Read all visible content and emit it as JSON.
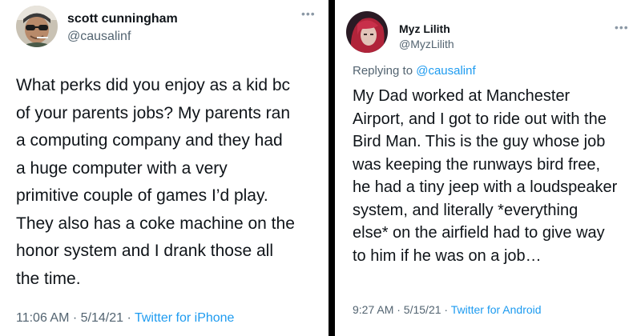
{
  "tweet_left": {
    "author_name": "scott cunningham",
    "author_handle": "@causalinf",
    "more_icon": "more-dots-icon",
    "lines": [
      "What perks did you enjoy as a kid bc",
      "of your parents jobs? My parents ran",
      "a computing company and they had",
      "a huge computer with a very",
      "primitive couple of games I’d play.",
      "They also has a coke machine on the",
      "honor system and I drank those all",
      "the time."
    ],
    "time": "11:06 AM · 5/14/21",
    "separator": " · ",
    "source": "Twitter for iPhone"
  },
  "tweet_right": {
    "author_name": "Myz Lilith",
    "author_handle": "@MyzLilith",
    "more_icon": "more-dots-icon",
    "replying_prefix": "Replying to ",
    "replying_to": "@causalinf",
    "lines": [
      "My Dad worked at Manchester",
      "Airport, and I got to ride out with the",
      "Bird Man. This is the guy whose job",
      "was keeping the runways bird free,",
      "he had a tiny jeep with a loudspeaker",
      "system, and literally *everything",
      "else* on the airfield had to give way",
      "to him if he was on a job…"
    ],
    "time": "9:27 AM · 5/15/21",
    "separator": " · ",
    "source": "Twitter for Android"
  },
  "colors": {
    "link": "#1d9bf0",
    "text": "#0f1419",
    "muted": "#536471",
    "divider": "#000000"
  }
}
